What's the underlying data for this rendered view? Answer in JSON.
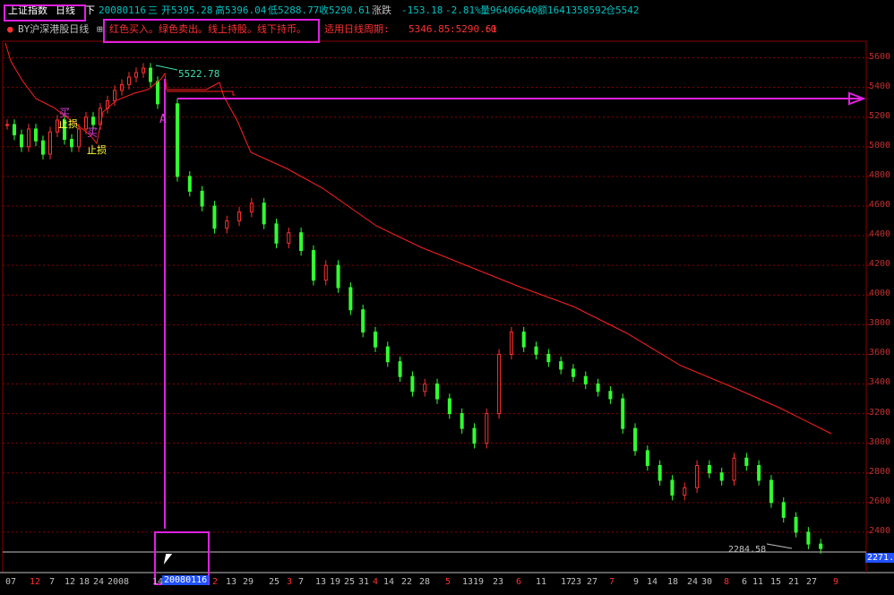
{
  "title": "上证指数",
  "period": "日线",
  "arrow_label": "下",
  "bar_info": {
    "date": "20080116",
    "weekday": "三",
    "open": "开5395.28",
    "high": "高5396.04",
    "low": "低5288.77",
    "close": "收5290.61",
    "change_label": "涨跌",
    "change": "-153.18",
    "change_pct": "-2.81%",
    "volume": "量96406640",
    "amount": "额1641358592",
    "position": "仓5542"
  },
  "indicator": {
    "name": "BY沪深港股日线",
    "toggle": "⊞",
    "desc": "红色买入。绿色卖出。线上持股。线下持币。",
    "period_label": "适用日线周期:",
    "value1": "5346.85",
    "value2": ":5290.61",
    "value3": ":0"
  },
  "annotations": {
    "peak_value": "5522.78",
    "low_value": "2284.58",
    "current_price": "2271.",
    "cursor_date": "20080116",
    "buy_mark": "买",
    "stop_mark": "止损",
    "peak_marker": "A"
  },
  "y_axis": [
    "5600",
    "5400",
    "5200",
    "5000",
    "4800",
    "4600",
    "4400",
    "4200",
    "4000",
    "3800",
    "3600",
    "3400",
    "3200",
    "3000",
    "2800",
    "2600",
    "2400"
  ],
  "x_axis": [
    {
      "t": "07",
      "c": "#c0c0c0"
    },
    {
      "t": "12",
      "c": "#ff3030"
    },
    {
      "t": "7",
      "c": "#c0c0c0"
    },
    {
      "t": "12",
      "c": "#c0c0c0"
    },
    {
      "t": "18",
      "c": "#c0c0c0"
    },
    {
      "t": "24",
      "c": "#c0c0c0"
    },
    {
      "t": "2008",
      "c": "#c0c0c0"
    },
    {
      "t": "14",
      "c": "#c0c0c0"
    },
    {
      "t": "2",
      "c": "#ff3030"
    },
    {
      "t": "13",
      "c": "#c0c0c0"
    },
    {
      "t": "29",
      "c": "#c0c0c0"
    },
    {
      "t": "25",
      "c": "#c0c0c0"
    },
    {
      "t": "3",
      "c": "#ff3030"
    },
    {
      "t": "7",
      "c": "#c0c0c0"
    },
    {
      "t": "13",
      "c": "#c0c0c0"
    },
    {
      "t": "19",
      "c": "#c0c0c0"
    },
    {
      "t": "25",
      "c": "#c0c0c0"
    },
    {
      "t": "31",
      "c": "#c0c0c0"
    },
    {
      "t": "4",
      "c": "#ff3030"
    },
    {
      "t": "14",
      "c": "#c0c0c0"
    },
    {
      "t": "22",
      "c": "#c0c0c0"
    },
    {
      "t": "28",
      "c": "#c0c0c0"
    },
    {
      "t": "5",
      "c": "#ff3030"
    },
    {
      "t": "13",
      "c": "#c0c0c0"
    },
    {
      "t": "19",
      "c": "#c0c0c0"
    },
    {
      "t": "23",
      "c": "#c0c0c0"
    },
    {
      "t": "6",
      "c": "#ff3030"
    },
    {
      "t": "11",
      "c": "#c0c0c0"
    },
    {
      "t": "17",
      "c": "#c0c0c0"
    },
    {
      "t": "23",
      "c": "#c0c0c0"
    },
    {
      "t": "27",
      "c": "#c0c0c0"
    },
    {
      "t": "7",
      "c": "#ff3030"
    },
    {
      "t": "9",
      "c": "#c0c0c0"
    },
    {
      "t": "14",
      "c": "#c0c0c0"
    },
    {
      "t": "18",
      "c": "#c0c0c0"
    },
    {
      "t": "24",
      "c": "#c0c0c0"
    },
    {
      "t": "30",
      "c": "#c0c0c0"
    },
    {
      "t": "8",
      "c": "#ff3030"
    },
    {
      "t": "6",
      "c": "#c0c0c0"
    },
    {
      "t": "11",
      "c": "#c0c0c0"
    },
    {
      "t": "15",
      "c": "#c0c0c0"
    },
    {
      "t": "21",
      "c": "#c0c0c0"
    },
    {
      "t": "27",
      "c": "#c0c0c0"
    },
    {
      "t": "9",
      "c": "#ff3030"
    }
  ],
  "colors": {
    "up": "#ff3030",
    "down": "#30ff30",
    "grid": "#8b0000",
    "ma": "#ff2020",
    "annotation": "#e020e0",
    "text": "#c0c0c0",
    "label_yellow": "#ffff40"
  },
  "chart_data": {
    "type": "candlestick",
    "ylim": [
      2200,
      5700
    ],
    "closes_rising_phase": [
      5150,
      5080,
      5000,
      5120,
      5040,
      4950,
      5100,
      5180,
      5050,
      5000,
      5120,
      5200,
      5150,
      5260,
      5310,
      5380,
      5420,
      5470,
      5500,
      5530,
      5440,
      5290
    ],
    "closes_falling_phase": [
      4800,
      4700,
      4600,
      4450,
      4500,
      4560,
      4620,
      4480,
      4350,
      4420,
      4300,
      4100,
      4200,
      4050,
      3900,
      3750,
      3650,
      3550,
      3450,
      3350,
      3400,
      3300,
      3200,
      3100,
      3000,
      3200,
      3600,
      3750,
      3650,
      3600,
      3550,
      3500,
      3450,
      3400,
      3350,
      3300,
      3100,
      2950,
      2850,
      2750,
      2650,
      2700,
      2850,
      2800,
      2750,
      2900,
      2850,
      2750,
      2600,
      2500,
      2400,
      2320,
      2290
    ]
  }
}
